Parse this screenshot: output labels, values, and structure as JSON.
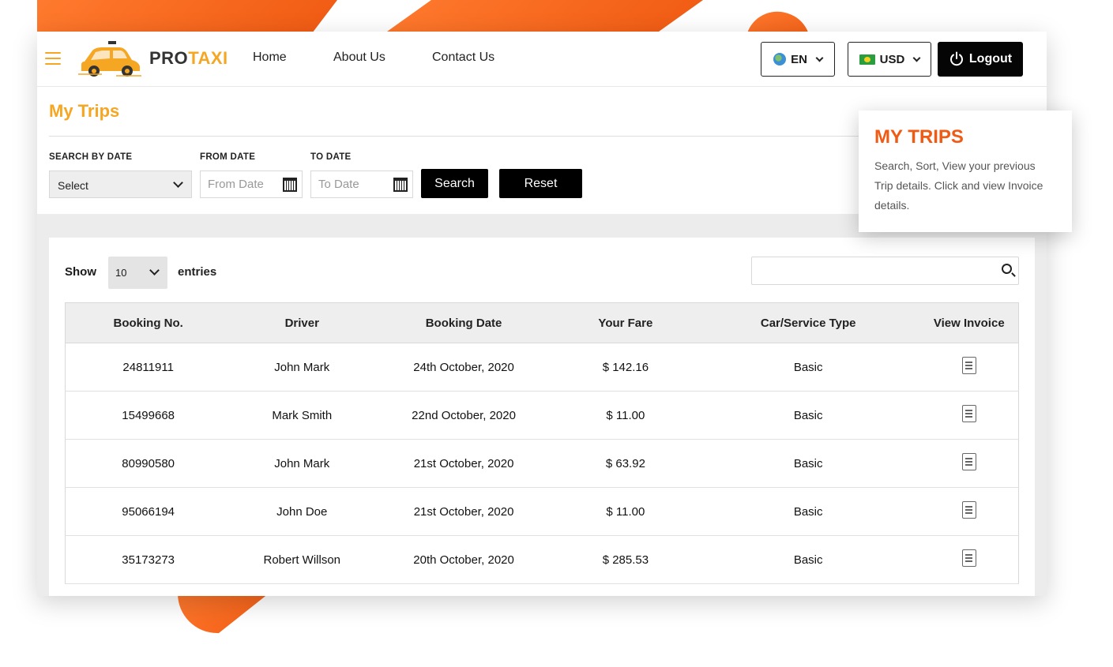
{
  "brand": {
    "pro": "PRO",
    "taxi": "TAXI"
  },
  "nav": {
    "home": "Home",
    "about": "About Us",
    "contact": "Contact Us"
  },
  "header": {
    "language": "EN",
    "currency": "USD",
    "logout": "Logout"
  },
  "page": {
    "title": "My Trips"
  },
  "filters": {
    "search_by_date_label": "SEARCH BY DATE",
    "search_by_date_value": "Select",
    "from_date_label": "FROM DATE",
    "from_date_placeholder": "From Date",
    "to_date_label": "TO DATE",
    "to_date_placeholder": "To Date",
    "search_button": "Search",
    "reset_button": "Reset"
  },
  "table_controls": {
    "show_label": "Show",
    "page_length": "10",
    "entries_label": "entries"
  },
  "table": {
    "headers": [
      "Booking No.",
      "Driver",
      "Booking Date",
      "Your Fare",
      "Car/Service Type",
      "View Invoice"
    ],
    "rows": [
      {
        "booking_no": "24811911",
        "driver": "John Mark",
        "date": "24th October, 2020",
        "fare": "$ 142.16",
        "type": "Basic"
      },
      {
        "booking_no": "15499668",
        "driver": "Mark Smith",
        "date": "22nd October, 2020",
        "fare": "$ 11.00",
        "type": "Basic"
      },
      {
        "booking_no": "80990580",
        "driver": "John Mark",
        "date": "21st October, 2020",
        "fare": "$ 63.92",
        "type": "Basic"
      },
      {
        "booking_no": "95066194",
        "driver": "John Doe",
        "date": "21st October, 2020",
        "fare": "$ 11.00",
        "type": "Basic"
      },
      {
        "booking_no": "35173273",
        "driver": "Robert Willson",
        "date": "20th October, 2020",
        "fare": "$ 285.53",
        "type": "Basic"
      }
    ]
  },
  "callout": {
    "title": "MY TRIPS",
    "text": "Search, Sort, View your previous Trip details. Click and view Invoice details."
  },
  "colors": {
    "accent": "#f5a623",
    "brand_orange": "#f05a12",
    "dark": "#000000"
  }
}
